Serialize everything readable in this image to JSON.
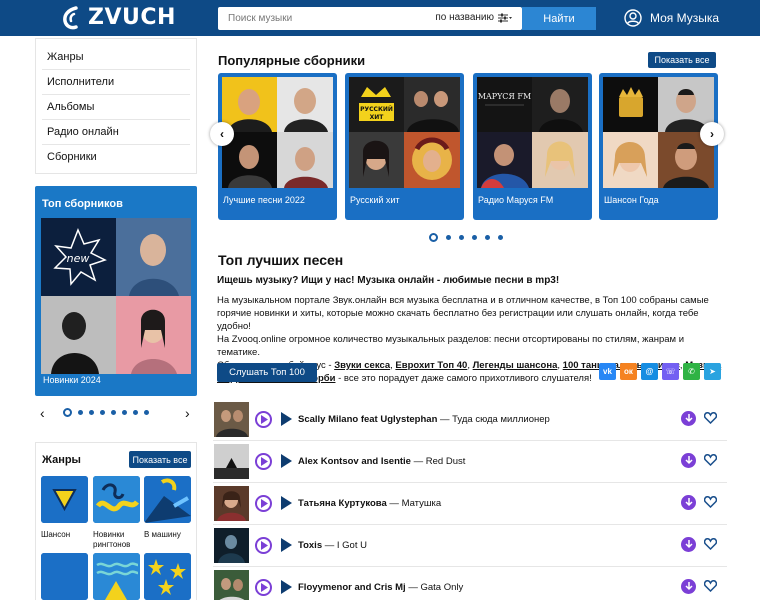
{
  "header": {
    "brand": "ZVUCH",
    "search_placeholder": "Поиск музыки",
    "search_mode": "по названию",
    "search_button": "Найти",
    "my_music": "Моя Музыка"
  },
  "sidebar": {
    "nav": [
      "Жанры",
      "Исполнители",
      "Альбомы",
      "Радио онлайн",
      "Сборники"
    ],
    "top_collections": {
      "title": "Топ сборников",
      "badge": "new",
      "caption": "Новинки 2024"
    },
    "genres": {
      "title": "Жанры",
      "show_all": "Показать все",
      "tiles": [
        "Шансон",
        "Новинки рингтонов",
        "В машину",
        "",
        "",
        ""
      ]
    }
  },
  "popular": {
    "title": "Популярные сборники",
    "show_all": "Показать все",
    "cards": [
      {
        "label": "Лучшие песни 2022"
      },
      {
        "label": "Русский хит",
        "cover_text": "РУССКИЙ ХИТ"
      },
      {
        "label": "Радио Маруся FM"
      },
      {
        "label": "Шансон Года"
      }
    ]
  },
  "top_songs": {
    "title": "Топ лучших песен",
    "intro_bold": "Ищешь музыку? Ищи у нас! Музыка онлайн - любимые песни в mp3!",
    "para1": "На музыкальном портале Звук.онлайн вся музыка бесплатна и в отличном качестве, в Топ 100 собраны самые горячие новинки и хиты, которые можно скачать бесплатно без регистрации или слушать онлайн, когда тебе удобно!",
    "para2": "На Zvooq.online огромное количество музыкальных разделов: песни отсортированы по стилям, жанрам и тематике.",
    "para3_prefix": "Сборники на любой вкус - ",
    "links": [
      "Звуки секса",
      "Еврохит Топ 40",
      "Легенды шансона",
      "100 танцевальных хитов",
      "Музыка на День памяти и скорби"
    ],
    "para3_suffix": " - все это порадует даже самого прихотливого слушателя!",
    "listen_button": "Слушать Топ 100"
  },
  "share": [
    "vk",
    "ok",
    "mail",
    "viber",
    "whatsapp",
    "telegram"
  ],
  "tracks": [
    {
      "artist": "Scally Milano feat Uglystephan",
      "title": "Туда сюда миллионер"
    },
    {
      "artist": "Alex Kontsov and Isentie",
      "title": "Red Dust"
    },
    {
      "artist": "Татьяна Куртукова",
      "title": "Матушка"
    },
    {
      "artist": "Toxis",
      "title": "I Got U"
    },
    {
      "artist": "Floyymenor and Cris Mj",
      "title": "Gata Only"
    }
  ],
  "colors": {
    "header": "#0e4a86",
    "accent": "#1a78c6",
    "play": "#7b3fd6"
  }
}
